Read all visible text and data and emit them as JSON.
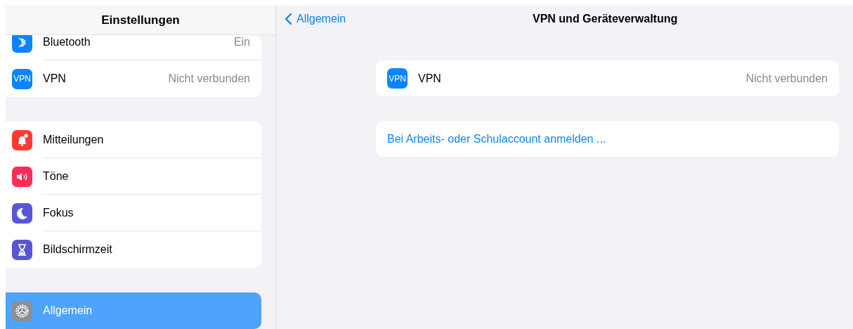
{
  "sidebar": {
    "title": "Einstellungen",
    "groups": [
      {
        "items": [
          {
            "label": "Bluetooth",
            "value": "Ein",
            "kind": "bluetooth",
            "color": "#0a84ff",
            "selected": false
          },
          {
            "label": "VPN",
            "value": "Nicht verbunden",
            "kind": "badge",
            "badge": "VPN",
            "color": "#0a84ff",
            "selected": false
          }
        ]
      },
      {
        "items": [
          {
            "label": "Mitteilungen",
            "kind": "bell",
            "color": "#ff3b30",
            "selected": false
          },
          {
            "label": "Töne",
            "kind": "speaker",
            "color": "#ff2d55",
            "selected": false
          },
          {
            "label": "Fokus",
            "kind": "moon",
            "color": "#5856d6",
            "selected": false
          },
          {
            "label": "Bildschirmzeit",
            "kind": "hourglass",
            "color": "#5856d6",
            "selected": false
          }
        ]
      },
      {
        "items": [
          {
            "label": "Allgemein",
            "kind": "gear",
            "color": "#8e8e93",
            "selected": true
          }
        ]
      }
    ]
  },
  "detail": {
    "back": "Allgemein",
    "title": "VPN und Geräteverwaltung",
    "vpn_row": {
      "badge": "VPN",
      "label": "VPN",
      "value": "Nicht verbunden"
    },
    "link": "Bei Arbeits- oder Schulaccount anmelden ..."
  }
}
